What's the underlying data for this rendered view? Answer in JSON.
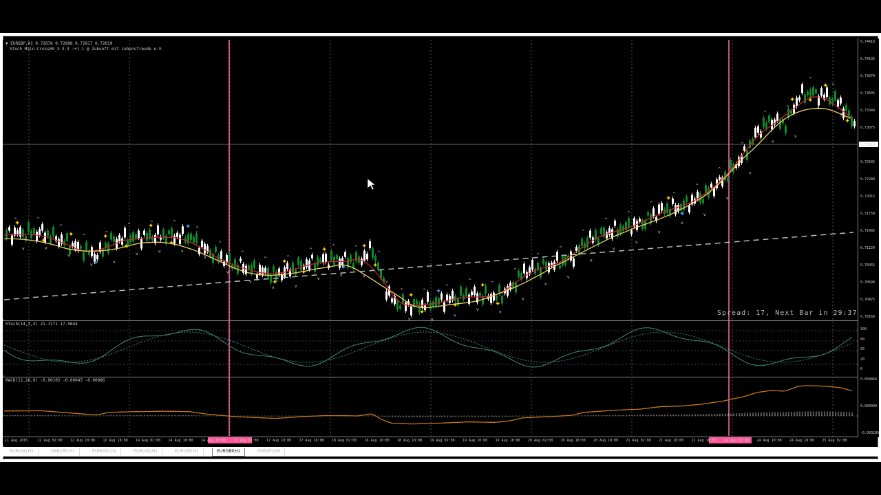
{
  "main_panel": {
    "header_line1": "▼ EURGBP,H1  0.72878 0.72898 0.72817 0.72819",
    "header_line2": "Stoch_Main-Cross00_3-3-3 :+1.1 @ Zukunft mit Lebensfreude e.V.",
    "spread_text": "Spread: 17, Next Bar in 29:37"
  },
  "stoch_panel": {
    "header": "Stoch(14,3,3) 21.7271 17.9644"
  },
  "macd_panel": {
    "header": "MACD(12,26,9) -0.00102 -0.00045 -0.00086"
  },
  "price_axis": [
    "0.74410",
    "0.74135",
    "0.73870",
    "0.73605",
    "0.73340",
    "0.73075",
    "0.72819",
    "0.72545",
    "0.72280",
    "0.72015",
    "0.71750",
    "0.71485",
    "0.71220",
    "0.70955",
    "0.70690",
    "0.70425",
    "0.70160"
  ],
  "stoch_axis": [
    "100",
    "80",
    "50",
    "20",
    "0"
  ],
  "macd_axis": [
    "0.004866",
    "0.000000",
    "-0.003289"
  ],
  "time_axis": [
    "11 Aug 2015",
    "12 Aug 02:00",
    "12 Aug 10:00",
    "12 Aug 18:00",
    "14 Aug 02:00",
    "14 Aug 10:00",
    "14 Aug 18:00",
    "17 Aug 02:00",
    "17 Aug 10:00",
    "17 Aug 18:00",
    "18 Aug 02:00",
    "18 Aug 10:00",
    "18 Aug 18:00",
    "19 Aug 02:00",
    "19 Aug 10:00",
    "19 Aug 18:00",
    "20 Aug 02:00",
    "20 Aug 10:00",
    "20 Aug 18:00",
    "21 Aug 02:00",
    "21 Aug 10:00",
    "21 Aug 18:00",
    "24 Aug 02:00",
    "24 Aug 10:00",
    "24 Aug 18:00",
    "25 Aug 02:00"
  ],
  "tabs": [
    "EURUSD,H1",
    "GBPUSD,H1",
    "EURUSD,H1",
    "EURUSD,H1",
    "EURUSD,H1",
    "EURGBP,H1",
    "EURJPY,M5"
  ],
  "active_tab_index": 5,
  "colors": {
    "bull": "#0c8a2a",
    "bear": "#ffffff",
    "ema_fast": "#d0202a",
    "ema_slow": "#f2d26a",
    "sma_long": "#bbbbbb",
    "signal_up": "#ffcc00",
    "signal_alt": "#3aa0ff",
    "vline": "#ff6fa8",
    "macd_line": "#c87a1a"
  }
}
